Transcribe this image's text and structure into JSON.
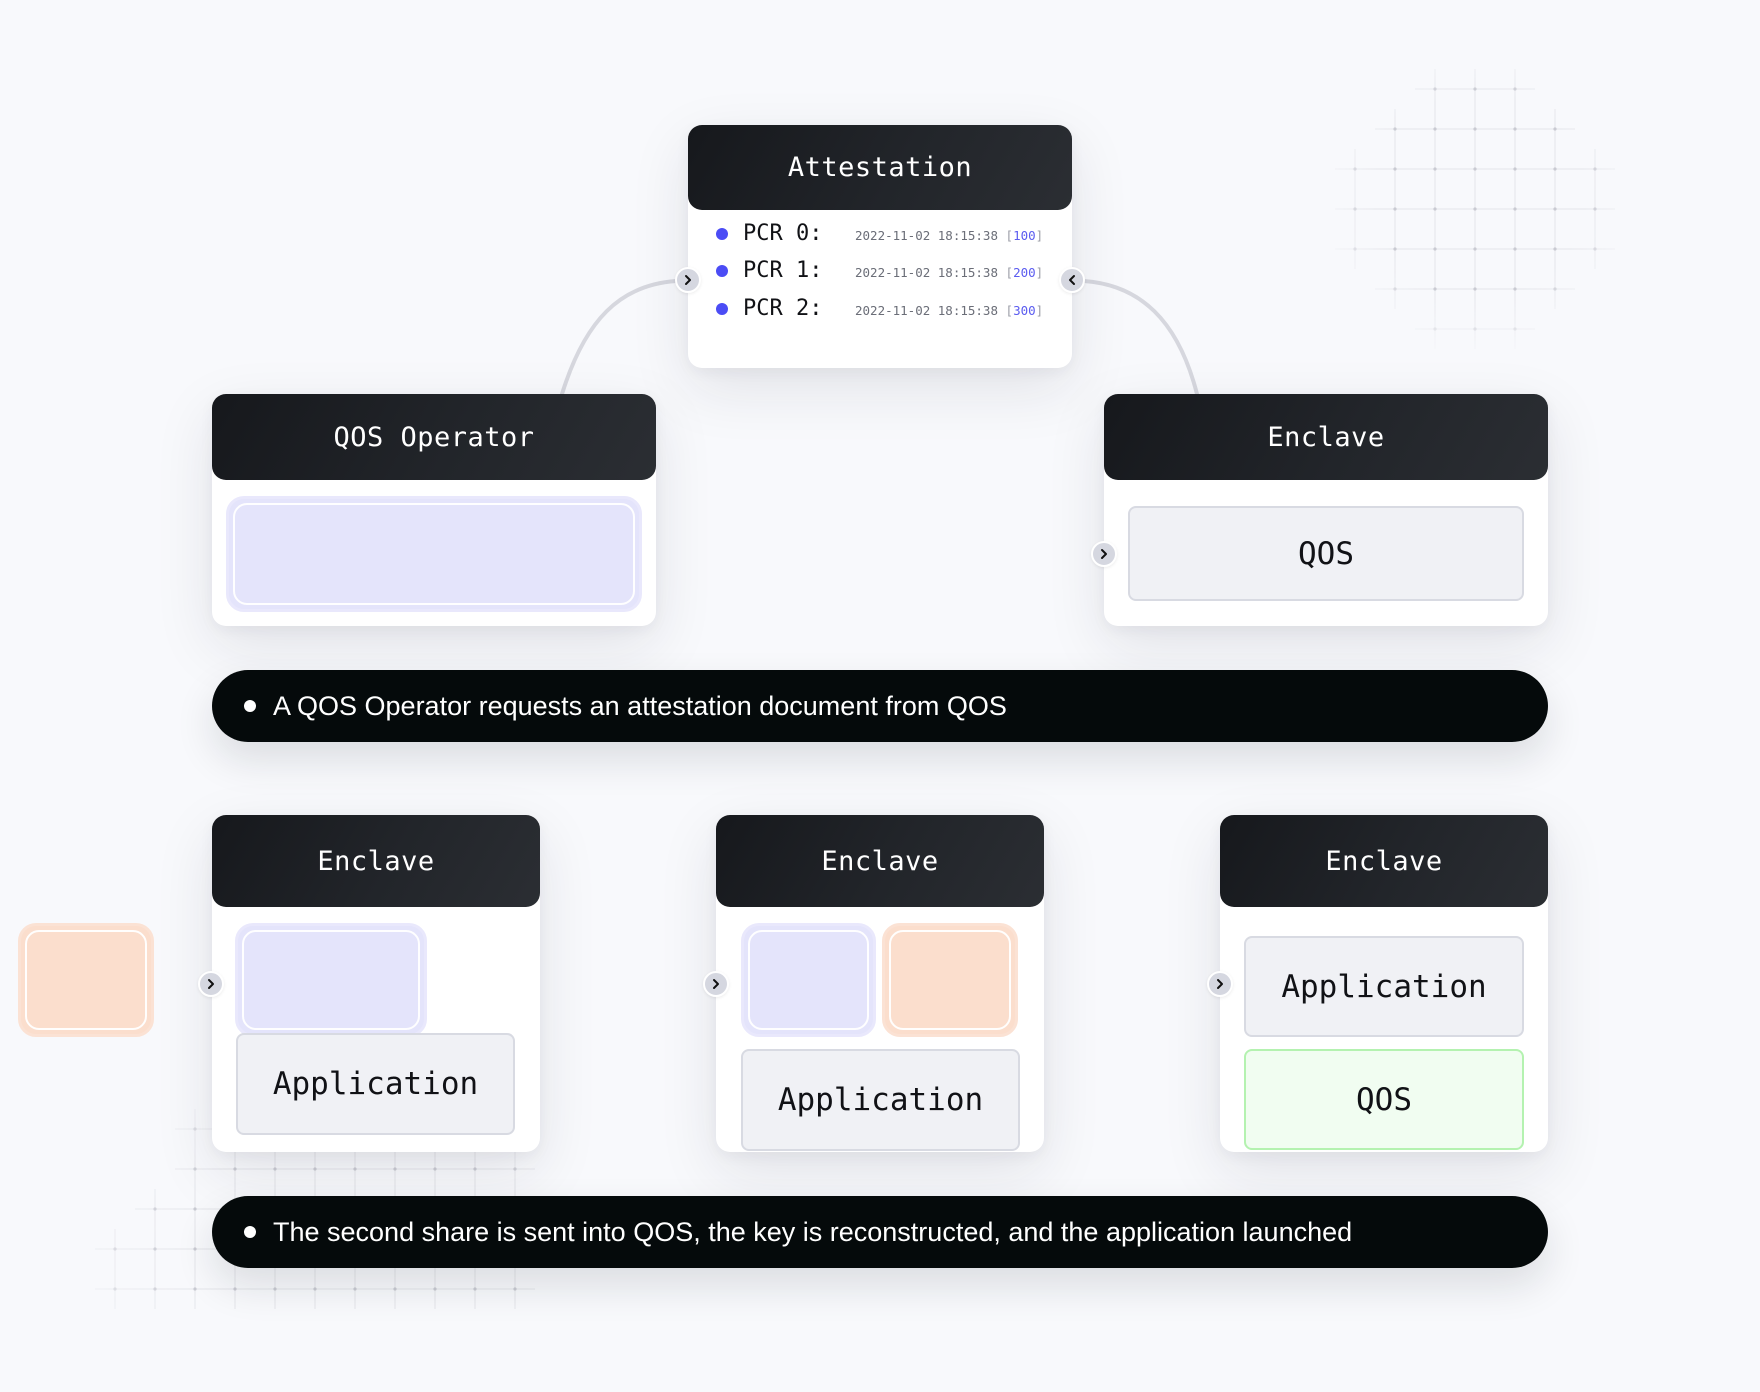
{
  "diagram": {
    "colors": {
      "background": "#f8f9fc",
      "header_dark": "#1c1e22",
      "caption_bg": "#050a0b",
      "share_purple": "#e4e4fb",
      "share_orange": "#fbdecd",
      "qos_green_bg": "#f1fdf1",
      "qos_green_border": "#b4f2b0",
      "pcr_dot": "#4b4cf5",
      "pcr_value": "#5b5cf0"
    },
    "step1": {
      "attestation": {
        "title": "Attestation",
        "pcrs": [
          {
            "label": "PCR 0:",
            "timestamp": "2022-11-02 18:15:38",
            "value": "100"
          },
          {
            "label": "PCR 1:",
            "timestamp": "2022-11-02 18:15:38",
            "value": "200"
          },
          {
            "label": "PCR 2:",
            "timestamp": "2022-11-02 18:15:38",
            "value": "300"
          }
        ]
      },
      "operator": {
        "title": "QOS Operator"
      },
      "enclave": {
        "title": "Enclave",
        "box": "QOS"
      },
      "caption": "A QOS Operator requests an attestation document from QOS"
    },
    "step2": {
      "enclaves": [
        {
          "title": "Enclave",
          "box": "Application"
        },
        {
          "title": "Enclave",
          "box": "Application"
        },
        {
          "title": "Enclave",
          "box_top": "Application",
          "box_bottom": "QOS"
        }
      ],
      "caption": "The second share is sent into QOS, the key is reconstructed, and the application launched"
    },
    "icons": {
      "connector_right": "chevron-right-icon",
      "connector_left": "chevron-left-icon"
    }
  }
}
